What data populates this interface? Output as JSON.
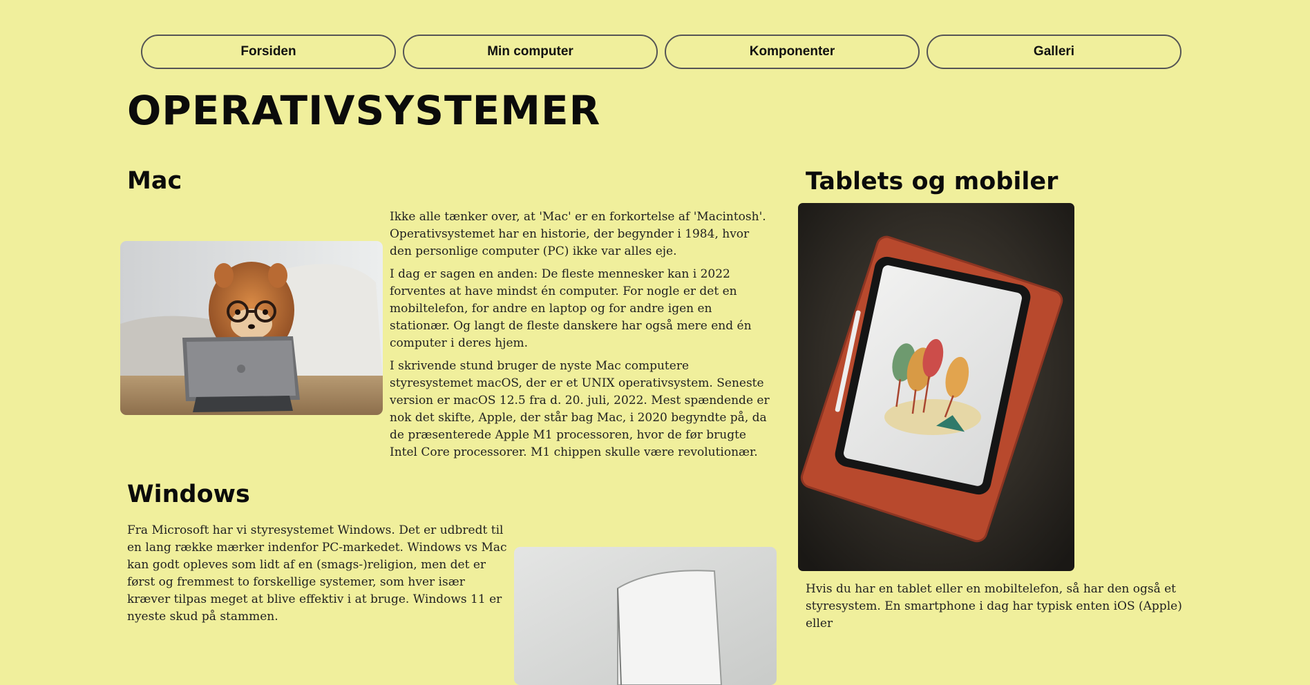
{
  "nav": {
    "items": [
      {
        "label": "Forsiden"
      },
      {
        "label": "Min computer"
      },
      {
        "label": "Komponenter"
      },
      {
        "label": "Galleri"
      }
    ]
  },
  "page": {
    "title": "OPERATIVSYSTEMER"
  },
  "mac": {
    "heading": "Mac",
    "paragraphs": [
      "Ikke alle tænker over, at 'Mac' er en forkortelse af 'Macintosh'. Operativsystemet har en historie, der begynder i 1984, hvor den personlige computer (PC) ikke var alles eje.",
      "I dag er sagen en anden: De fleste mennesker kan i 2022 forventes at have mindst én computer. For nogle er det en mobiltelefon, for andre en laptop og for andre igen en stationær. Og langt de fleste danskere har også mere end én computer i deres hjem.",
      "I skrivende stund bruger de nyste Mac computere styresystemet macOS, der er et UNIX operativsystem. Seneste version er macOS 12.5 fra d. 20. juli, 2022. Mest spændende er nok det skifte, Apple, der står bag Mac, i 2020 begyndte på, da de præsenterede Apple M1 processoren, hvor de før brugte Intel Core processorer. M1 chippen skulle være revolutionær."
    ]
  },
  "windows": {
    "heading": "Windows",
    "paragraphs": [
      "Fra Microsoft har vi styresystemet Windows. Det er udbredt til en lang række mærker indenfor PC-markedet. Windows vs Mac kan godt opleves som lidt af en (smags-)religion, men det er først og fremmest to forskellige systemer, som hver især kræver tilpas meget at blive effektiv i at bruge. Windows 11 er nyeste skud på stammen."
    ]
  },
  "tablets": {
    "heading": "Tablets og mobiler",
    "paragraphs": [
      "Hvis du har en tablet eller en mobiltelefon, så har den også et styresystem. En smartphone i dag har typisk enten iOS (Apple) eller"
    ]
  },
  "icons": {
    "mac_image": "dog-with-glasses-and-tablet-photo",
    "windows_image": "laptop-photo",
    "tablet_image": "tablet-with-tree-drawing-photo"
  },
  "colors": {
    "background": "#f0ef9c",
    "nav_border": "#555555",
    "text": "#111111"
  }
}
